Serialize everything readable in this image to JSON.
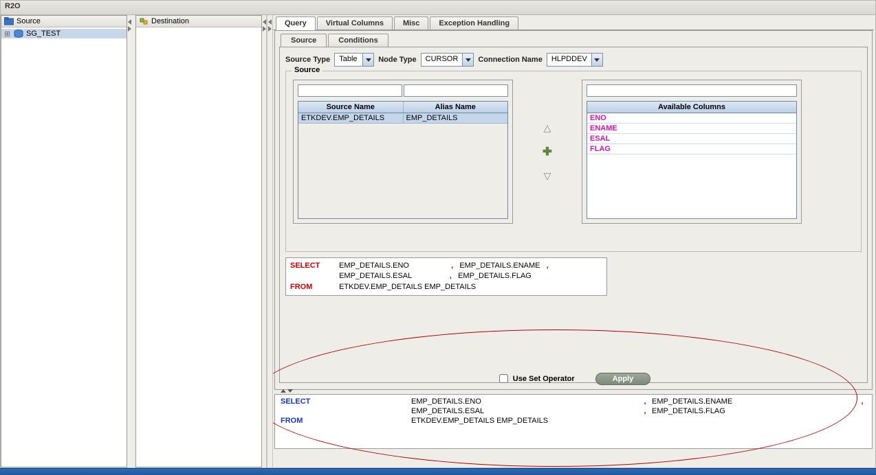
{
  "window": {
    "title": "R2O"
  },
  "tree_source": {
    "header": "Source",
    "items": [
      {
        "label": "SG_TEST",
        "selected": true
      }
    ]
  },
  "tree_dest": {
    "header": "Destination"
  },
  "top_tabs": {
    "query": "Query",
    "virtual": "Virtual Columns",
    "misc": "Misc",
    "exception": "Exception Handling"
  },
  "sub_tabs": {
    "source": "Source",
    "conditions": "Conditions"
  },
  "form": {
    "source_type_label": "Source Type",
    "source_type_value": "Table",
    "node_type_label": "Node Type",
    "node_type_value": "CURSOR",
    "conn_label": "Connection Name",
    "conn_value": "HLPDDEV"
  },
  "fieldset_legend": "Source",
  "src_grid": {
    "head_source": "Source Name",
    "head_alias": "Alias Name",
    "rows": [
      {
        "source": "ETKDEV.EMP_DETAILS",
        "alias": "EMP_DETAILS"
      }
    ]
  },
  "cols_grid": {
    "head": "Available Columns",
    "items": [
      "ENO",
      "ENAME",
      "ESAL",
      "FLAG"
    ]
  },
  "sql_preview": {
    "select_kw": "SELECT",
    "from_kw": "FROM",
    "cols": [
      "EMP_DETAILS.ENO",
      "EMP_DETAILS.ENAME",
      "EMP_DETAILS.ESAL",
      "EMP_DETAILS.FLAG"
    ],
    "from_clause": "ETKDEV.EMP_DETAILS EMP_DETAILS"
  },
  "inner_bottom": {
    "use_set": "Use Set Operator",
    "apply": "Apply"
  },
  "lower_sql": {
    "select_kw": "SELECT",
    "from_kw": "FROM",
    "c1": "EMP_DETAILS.ENO",
    "c2": "EMP_DETAILS.ENAME",
    "c3": "EMP_DETAILS.ESAL",
    "c4": "EMP_DETAILS.FLAG",
    "from_clause": "ETKDEV.EMP_DETAILS EMP_DETAILS"
  }
}
